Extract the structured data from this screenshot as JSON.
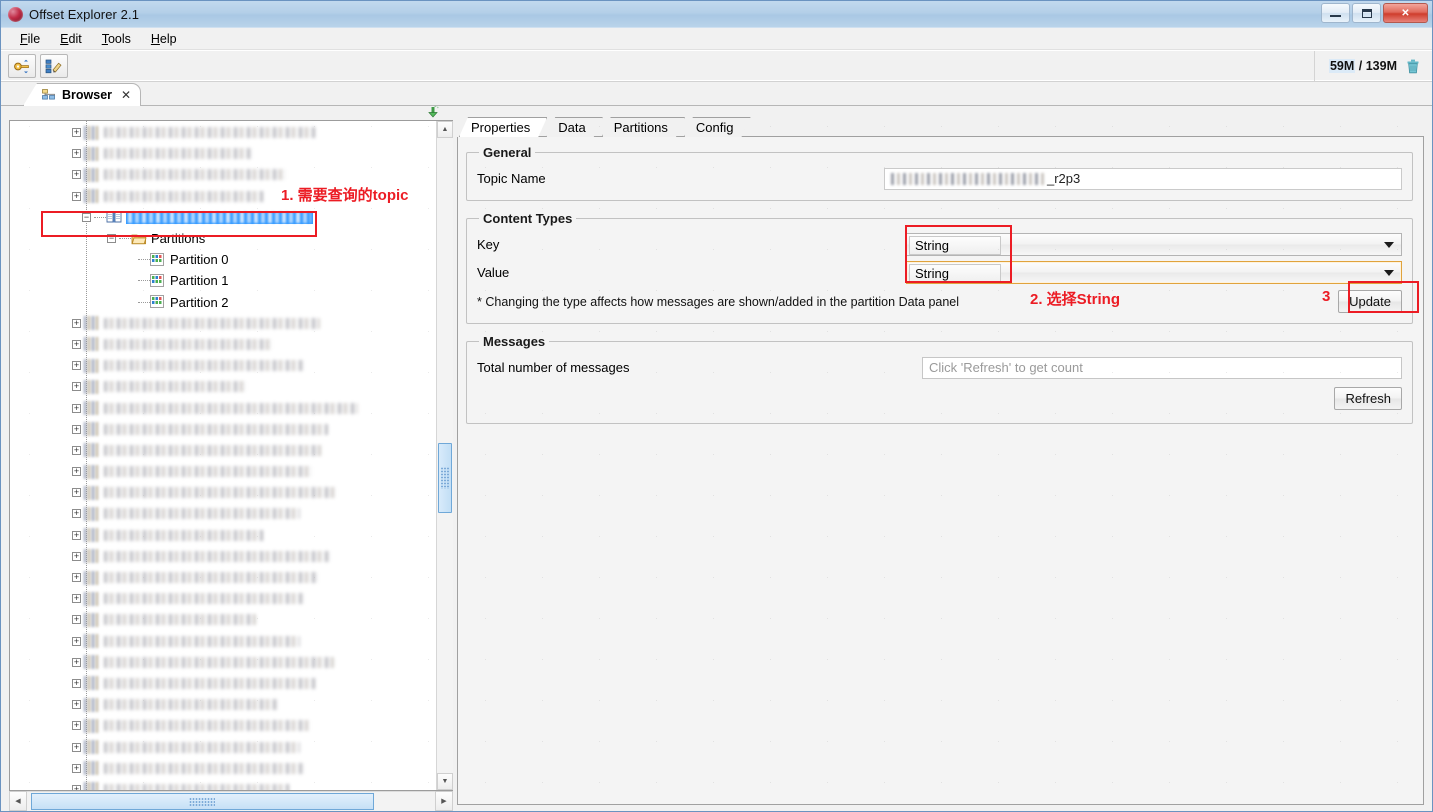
{
  "window": {
    "title": "Offset Explorer  2.1",
    "app_icon": "offset-explorer-icon",
    "minimize": "—",
    "maximize": "□",
    "close": "✕"
  },
  "menu": {
    "items": [
      {
        "label": "File",
        "mnemonic": "F"
      },
      {
        "label": "Edit",
        "mnemonic": "E"
      },
      {
        "label": "Tools",
        "mnemonic": "T"
      },
      {
        "label": "Help",
        "mnemonic": "H"
      }
    ]
  },
  "toolbar": {
    "buttons": [
      {
        "name": "add-connection-button",
        "icon": "connection-key-icon"
      },
      {
        "name": "edit-cluster-button",
        "icon": "edit-cluster-icon"
      }
    ],
    "memory": {
      "used": "59M",
      "separator": "/",
      "total": "139M",
      "icon": "trash-icon"
    }
  },
  "editor_tabs": {
    "items": [
      {
        "label": "Browser",
        "icon": "browser-tree-icon",
        "close": "✕",
        "active": true
      }
    ]
  },
  "tree": {
    "collapse_icon": "collapse-all-icon",
    "selected_topic": "sungrow_queue_commands_r2p3",
    "rows_above": 4,
    "children": [
      {
        "label": "Partitions",
        "icon": "folder-icon",
        "level": 2
      },
      {
        "label": "Partition 0",
        "icon": "partition-icon",
        "level": 3
      },
      {
        "label": "Partition 1",
        "icon": "partition-icon",
        "level": 3
      },
      {
        "label": "Partition 2",
        "icon": "partition-icon",
        "level": 3
      }
    ],
    "rows_below": 23,
    "scrollbar": {
      "up_arrow": "▲",
      "down_arrow": "▼",
      "left_arrow": "◀",
      "right_arrow": "▶"
    }
  },
  "properties": {
    "tabs": [
      {
        "label": "Properties",
        "active": true
      },
      {
        "label": "Data",
        "active": false
      },
      {
        "label": "Partitions",
        "active": false
      },
      {
        "label": "Config",
        "active": false
      }
    ],
    "general": {
      "legend": "General",
      "topic_name_label": "Topic Name",
      "topic_name_suffix": "_r2p3"
    },
    "content_types": {
      "legend": "Content Types",
      "key_label": "Key",
      "key_value": "String",
      "value_label": "Value",
      "value_value": "String",
      "note": "* Changing the type affects how messages are shown/added in the partition Data panel",
      "update_button": "Update"
    },
    "messages": {
      "legend": "Messages",
      "total_label": "Total number of messages",
      "count_placeholder": "Click 'Refresh' to get count",
      "refresh_button": "Refresh"
    }
  },
  "annotations": {
    "step1": "1. 需要查询的topic",
    "step2": "2. 选择String",
    "step3": "3",
    "accent_color": "#ec1c24"
  }
}
